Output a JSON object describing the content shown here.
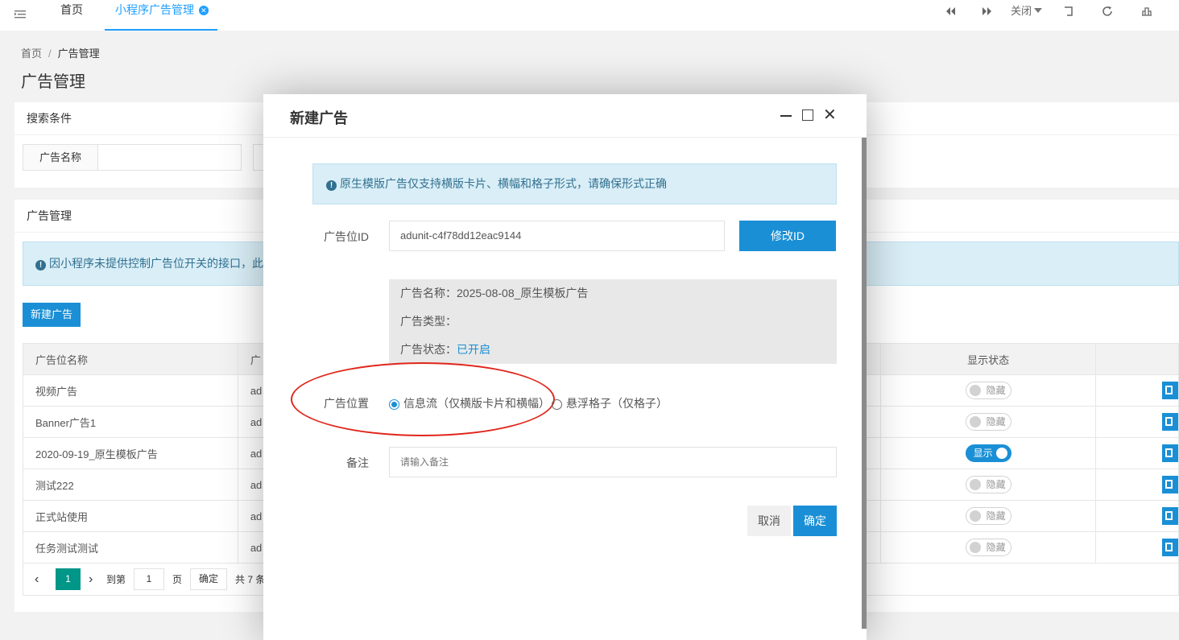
{
  "topbar": {
    "tabs": [
      {
        "label": "首页"
      },
      {
        "label": "小程序广告管理"
      }
    ],
    "close_menu_label": "关闭"
  },
  "page": {
    "breadcrumb": [
      "首页",
      "广告管理"
    ],
    "title": "广告管理"
  },
  "search": {
    "header": "搜索条件",
    "name_label": "广告名称"
  },
  "ad_list": {
    "header": "广告管理",
    "notice": "因小程序未提供控制广告位开关的接口，此",
    "new_button": "新建广告",
    "columns": [
      "广告位名称",
      "广",
      "显示状态"
    ],
    "rows": [
      {
        "name": "视频广告",
        "id": "ad",
        "status": "隐藏",
        "on": false
      },
      {
        "name": "Banner广告1",
        "id": "ad",
        "status": "隐藏",
        "on": false
      },
      {
        "name": "2020-09-19_原生模板广告",
        "id": "ad",
        "status": "显示",
        "on": true
      },
      {
        "name": "测试222",
        "id": "ad",
        "status": "隐藏",
        "on": false
      },
      {
        "name": "正式站使用",
        "id": "ad",
        "status": "隐藏",
        "on": false
      },
      {
        "name": "任务测试测试",
        "id": "ad",
        "status": "隐藏",
        "on": false
      }
    ],
    "pager": {
      "current_page": "1",
      "goto_label": "到第",
      "goto_value": "1",
      "page_unit": "页",
      "confirm": "确定",
      "total": "共 7 条"
    }
  },
  "modal": {
    "title": "新建广告",
    "alert": "原生模版广告仅支持横版卡片、横幅和格子形式，请确保形式正确",
    "ad_id_label": "广告位ID",
    "ad_id_value": "adunit-c4f78dd12eac9144",
    "modify_id_button": "修改ID",
    "info": {
      "name_label": "广告名称：",
      "name_value": "2025-08-08_原生模板广告",
      "type_label": "广告类型：",
      "type_value": "",
      "status_label": "广告状态：",
      "status_value": "已开启"
    },
    "position_label": "广告位置",
    "position_options": [
      {
        "label": "信息流（仅横版卡片和横幅）",
        "checked": true
      },
      {
        "label": "悬浮格子（仅格子）",
        "checked": false
      }
    ],
    "remark_label": "备注",
    "remark_placeholder": "请输入备注",
    "cancel_button": "取消",
    "ok_button": "确定"
  },
  "colors": {
    "accent": "#1a8fd6",
    "tab_active": "#1e9fff",
    "pager_active": "#009688",
    "highlight_ellipse": "#e0261b",
    "alert_bg": "#d9eef7"
  }
}
